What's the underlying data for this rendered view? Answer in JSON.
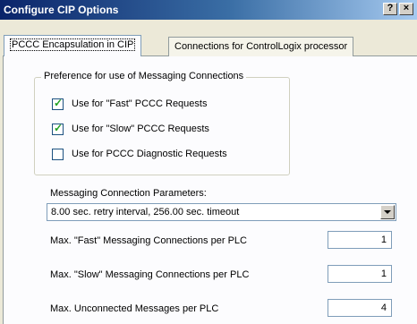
{
  "window": {
    "title": "Configure CIP Options",
    "help_label": "?",
    "close_label": "×"
  },
  "tabs": [
    {
      "label": "PCCC Encapsulation in CIP",
      "active": true
    },
    {
      "label": "Connections for ControlLogix processor",
      "active": false
    }
  ],
  "preference_group": {
    "title": "Preference for use of Messaging Connections",
    "checkboxes": [
      {
        "label": "Use for \"Fast\" PCCC Requests",
        "checked": true,
        "mark": "✓"
      },
      {
        "label": "Use for \"Slow\" PCCC Requests",
        "checked": true,
        "mark": "✓"
      },
      {
        "label": "Use for PCCC Diagnostic Requests",
        "checked": false,
        "mark": ""
      }
    ]
  },
  "parameters": {
    "label": "Messaging Connection Parameters:",
    "selected": "8.00 sec. retry interval, 256.00 sec. timeout"
  },
  "fields": [
    {
      "label": "Max. \"Fast\" Messaging Connections per PLC",
      "value": "1"
    },
    {
      "label": "Max. \"Slow\" Messaging Connections per PLC",
      "value": "1"
    },
    {
      "label": "Max. Unconnected Messages per PLC",
      "value": "4"
    }
  ]
}
